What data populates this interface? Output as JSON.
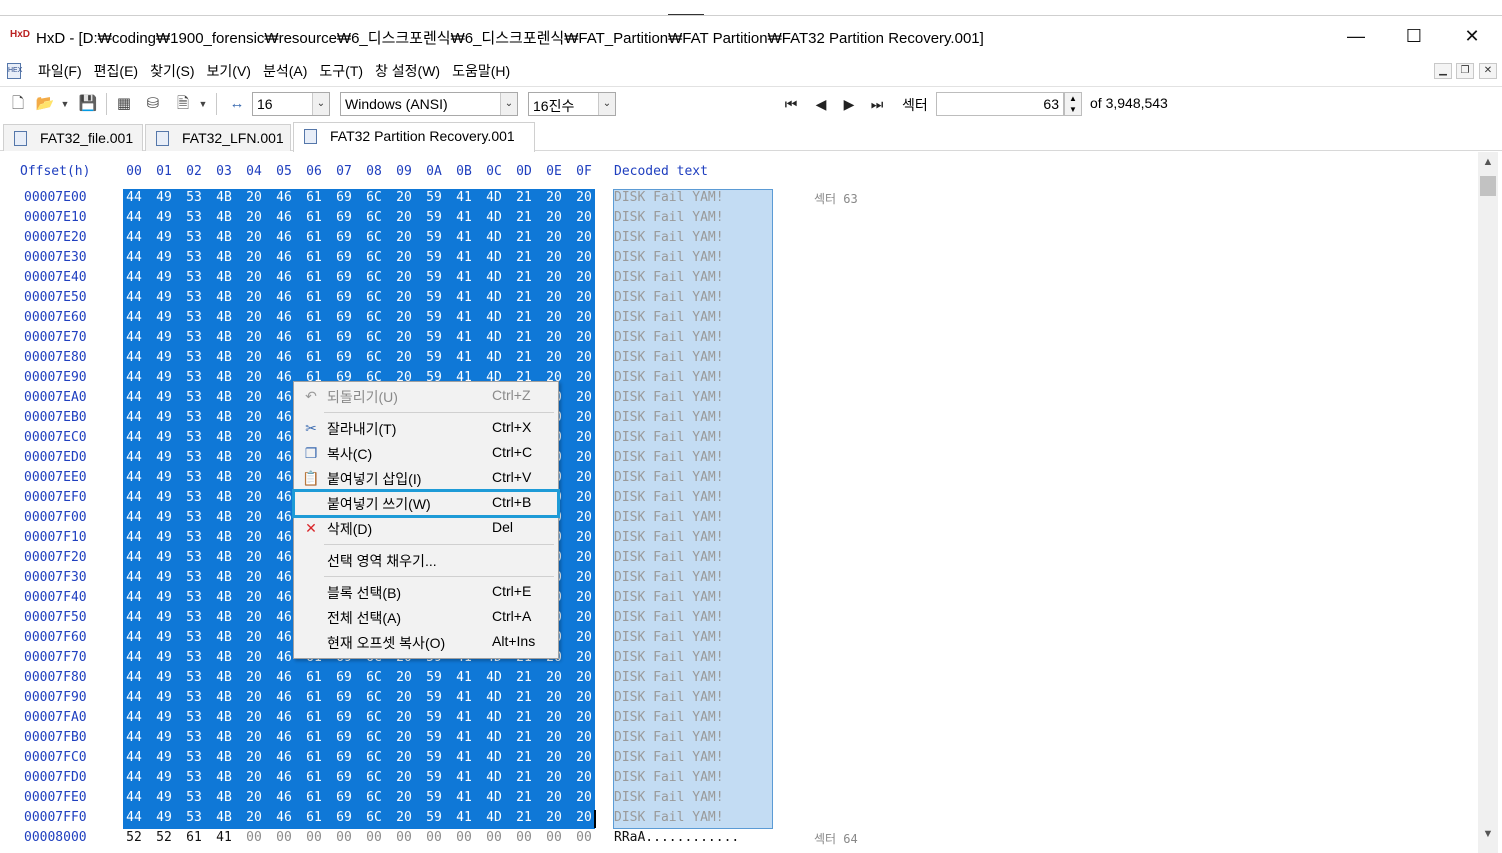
{
  "window": {
    "app_icon": "HxD",
    "title": "HxD - [D:₩coding₩1900_forensic₩resource₩6_디스크포렌식₩6_디스크포렌식₩FAT_Partition₩FAT Partition₩FAT32 Partition Recovery.001]",
    "controls": {
      "minimize": "—",
      "maximize": "☐",
      "close": "✕"
    }
  },
  "menubar": {
    "items": [
      "파일(F)",
      "편집(E)",
      "찾기(S)",
      "보기(V)",
      "분석(A)",
      "도구(T)",
      "창 설정(W)",
      "도움말(H)"
    ],
    "mdi": {
      "minimize": "▁",
      "restore": "❐",
      "close": "✕"
    }
  },
  "toolbar": {
    "bytes_per_row": "16",
    "charset": "Windows (ANSI)",
    "base": "16진수",
    "sector_label": "섹터",
    "sector_value": "63",
    "sector_total": "of 3,948,543"
  },
  "tabs": [
    {
      "label": "FAT32_file.001",
      "active": false
    },
    {
      "label": "FAT32_LFN.001",
      "active": false
    },
    {
      "label": "FAT32 Partition Recovery.001",
      "active": true
    }
  ],
  "editor": {
    "offset_header": "Offset(h)",
    "column_headers": [
      "00",
      "01",
      "02",
      "03",
      "04",
      "05",
      "06",
      "07",
      "08",
      "09",
      "0A",
      "0B",
      "0C",
      "0D",
      "0E",
      "0F"
    ],
    "decoded_header": "Decoded text",
    "selected_bytes": [
      "44",
      "49",
      "53",
      "4B",
      "20",
      "46",
      "61",
      "69",
      "6C",
      "20",
      "59",
      "41",
      "4D",
      "21",
      "20",
      "20"
    ],
    "selected_text": "DISK Fail YAM!",
    "offsets": [
      "00007E00",
      "00007E10",
      "00007E20",
      "00007E30",
      "00007E40",
      "00007E50",
      "00007E60",
      "00007E70",
      "00007E80",
      "00007E90",
      "00007EA0",
      "00007EB0",
      "00007EC0",
      "00007ED0",
      "00007EE0",
      "00007EF0",
      "00007F00",
      "00007F10",
      "00007F20",
      "00007F30",
      "00007F40",
      "00007F50",
      "00007F60",
      "00007F70",
      "00007F80",
      "00007F90",
      "00007FA0",
      "00007FB0",
      "00007FC0",
      "00007FD0",
      "00007FE0",
      "00007FF0"
    ],
    "last_row": {
      "offset": "00008000",
      "bytes": [
        "52",
        "52",
        "61",
        "41",
        "00",
        "00",
        "00",
        "00",
        "00",
        "00",
        "00",
        "00",
        "00",
        "00",
        "00",
        "00"
      ],
      "text": "RRaA............"
    },
    "sector_annotations": {
      "first": "섹터 63",
      "last": "섹터 64"
    }
  },
  "context_menu": {
    "items": [
      {
        "label": "되돌리기(U)",
        "shortcut": "Ctrl+Z",
        "icon": "undo-icon",
        "glyph": "↶",
        "disabled": true
      },
      {
        "separator": true
      },
      {
        "label": "잘라내기(T)",
        "shortcut": "Ctrl+X",
        "icon": "scissors-icon",
        "glyph": "✂"
      },
      {
        "label": "복사(C)",
        "shortcut": "Ctrl+C",
        "icon": "copy-icon",
        "glyph": "❐"
      },
      {
        "label": "붙여넣기 삽입(I)",
        "shortcut": "Ctrl+V",
        "icon": "paste-icon",
        "glyph": "📋"
      },
      {
        "label": "붙여넣기 쓰기(W)",
        "shortcut": "Ctrl+B",
        "icon": "",
        "glyph": "",
        "highlighted": true
      },
      {
        "label": "삭제(D)",
        "shortcut": "Del",
        "icon": "delete-icon",
        "glyph": "✕"
      },
      {
        "separator": true
      },
      {
        "label": "선택 영역 채우기...",
        "shortcut": "",
        "icon": "",
        "glyph": ""
      },
      {
        "separator": true
      },
      {
        "label": "블록 선택(B)",
        "shortcut": "Ctrl+E",
        "icon": "",
        "glyph": ""
      },
      {
        "label": "전체 선택(A)",
        "shortcut": "Ctrl+A",
        "icon": "",
        "glyph": ""
      },
      {
        "label": "현재 오프셋 복사(O)",
        "shortcut": "Alt+Ins",
        "icon": "",
        "glyph": ""
      }
    ]
  },
  "colors": {
    "selection_hex": "#0f78d7",
    "selection_text": "#c3dcf3",
    "offset_blue": "#1f3fbf",
    "highlight_outline": "#1e9bd7",
    "delete_red": "#d9262a"
  }
}
